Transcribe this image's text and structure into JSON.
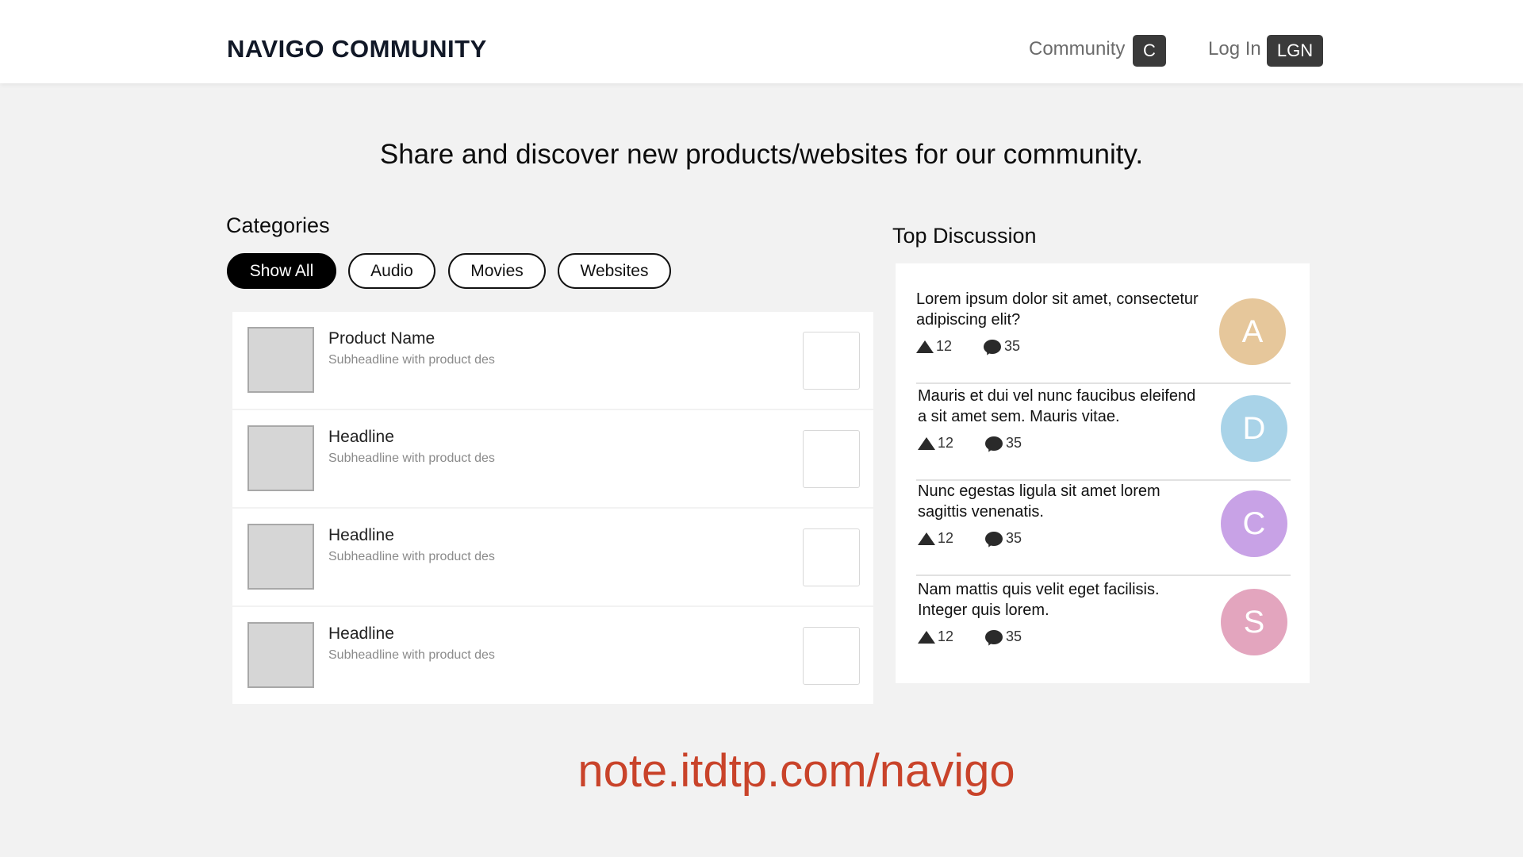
{
  "header": {
    "logo": "NAVIGO COMMUNITY",
    "nav": [
      {
        "label": "Community",
        "badge": "C"
      },
      {
        "label": "Log In",
        "badge": "LGN"
      }
    ]
  },
  "hero": {
    "headline": "Share and discover new products/websites for our community."
  },
  "categories": {
    "title": "Categories",
    "chips": [
      {
        "label": "Show All",
        "active": true
      },
      {
        "label": "Audio",
        "active": false
      },
      {
        "label": "Movies",
        "active": false
      },
      {
        "label": "Websites",
        "active": false
      }
    ]
  },
  "products": [
    {
      "title": "Product Name",
      "subtitle": "Subheadline with product des"
    },
    {
      "title": "Headline",
      "subtitle": "Subheadline with product des"
    },
    {
      "title": "Headline",
      "subtitle": "Subheadline with product des"
    },
    {
      "title": "Headline",
      "subtitle": "Subheadline with product des"
    }
  ],
  "discussion": {
    "title": "Top Discussion",
    "items": [
      {
        "text": "Lorem ipsum dolor sit amet, consectetur adipiscing elit?",
        "upvotes": "12",
        "comments": "35",
        "avatar_letter": "A",
        "avatar_color": "#e6c79b"
      },
      {
        "text": "Mauris et dui vel nunc faucibus eleifend a sit amet sem. Mauris vitae.",
        "upvotes": "12",
        "comments": "35",
        "avatar_letter": "D",
        "avatar_color": "#a9d3e8"
      },
      {
        "text": "Nunc egestas ligula sit amet lorem sagittis venenatis.",
        "upvotes": "12",
        "comments": "35",
        "avatar_letter": "C",
        "avatar_color": "#c8a2e6"
      },
      {
        "text": "Nam mattis quis velit eget facilisis. Integer quis lorem.",
        "upvotes": "12",
        "comments": "35",
        "avatar_letter": "S",
        "avatar_color": "#e3a5be"
      }
    ]
  },
  "footer": {
    "link": "note.itdtp.com/navigo"
  }
}
